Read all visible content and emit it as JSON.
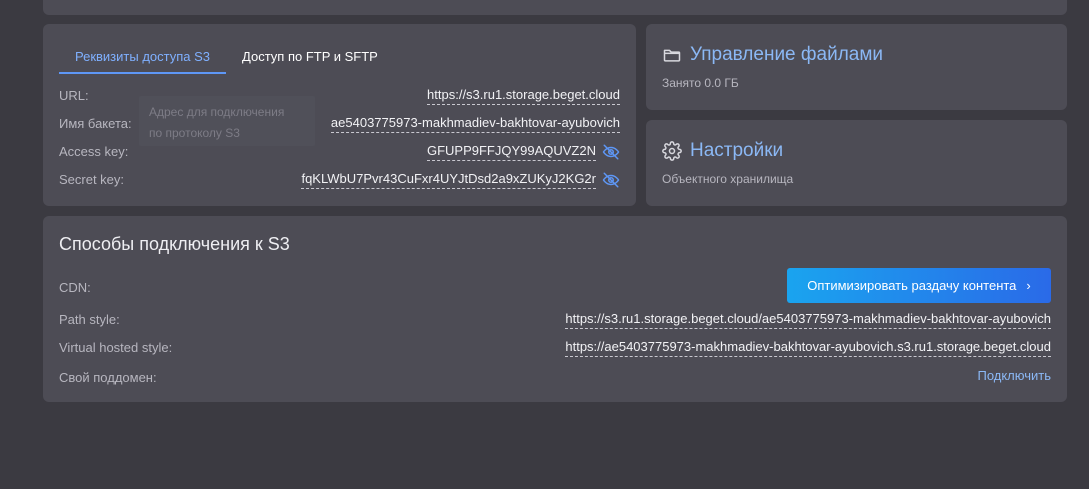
{
  "tabs": {
    "s3_credentials": "Реквизиты доступа S3",
    "ftp_sftp": "Доступ по FTP и SFTP"
  },
  "tooltip": {
    "line1": "Адрес для подключения",
    "line2": "по протоколу S3"
  },
  "credentials": {
    "url_label": "URL:",
    "url_value": "https://s3.ru1.storage.beget.cloud",
    "bucket_label": "Имя бакета:",
    "bucket_value": "ae5403775973-makhmadiev-bakhtovar-ayubovich",
    "access_label": "Access key:",
    "access_value": "GFUPP9FFJQY99AQUVZ2N",
    "secret_label": "Secret key:",
    "secret_value": "fqKLWbU7Pvr43CuFxr4UYJtDsd2a9xZUKyJ2KG2r"
  },
  "files": {
    "title": "Управление файлами",
    "subtitle": "Занято 0.0 ГБ"
  },
  "settings": {
    "title": "Настройки",
    "subtitle": "Объектного хранилища"
  },
  "s3_connection": {
    "title": "Способы подключения к S3",
    "cdn_label": "CDN:",
    "cdn_button": "Оптимизировать раздачу контента",
    "path_label": "Path style:",
    "path_value": "https://s3.ru1.storage.beget.cloud/ae5403775973-makhmadiev-bakhtovar-ayubovich",
    "vhost_label": "Virtual hosted style:",
    "vhost_value": "https://ae5403775973-makhmadiev-bakhtovar-ayubovich.s3.ru1.storage.beget.cloud",
    "subdomain_label": "Свой поддомен:",
    "connect_link": "Подключить"
  },
  "icons": {
    "folder": "folder-icon",
    "gear": "gear-icon",
    "eye_off": "eye-off-icon",
    "chevron": "chevron-right-icon"
  },
  "colors": {
    "background": "#3b3a41",
    "card": "#4d4c55",
    "accent": "#8bb8f5",
    "button_gradient_start": "#1aa4ef",
    "button_gradient_end": "#2a6ae8"
  }
}
